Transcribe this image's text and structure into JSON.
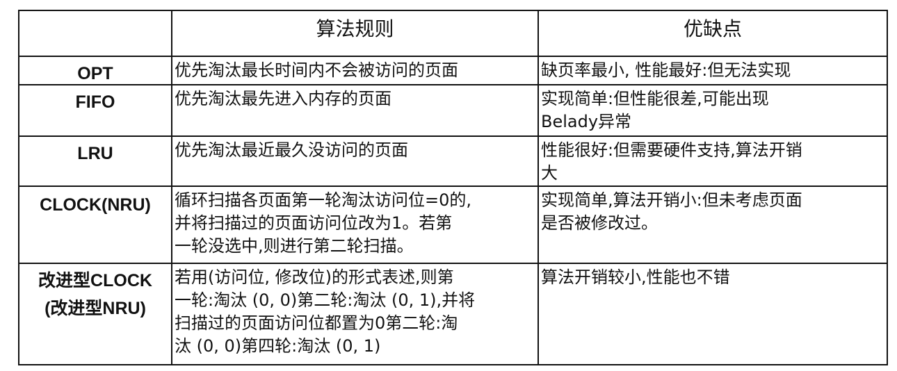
{
  "header": {
    "col1": "",
    "col2": "算法规则",
    "col3": "优缺点"
  },
  "rows": [
    {
      "name": "OPT",
      "rule": "优先淘汰最长时间内不会被访问的页面",
      "pros_cons": "缺页率最小, 性能最好:但无法实现"
    },
    {
      "name": "FIFO",
      "rule": "优先淘汰最先进入内存的页面",
      "pros_cons": "实现简单:但性能很差,可能出现\nBelady异常"
    },
    {
      "name": "LRU",
      "rule": "优先淘汰最近最久没访问的页面",
      "pros_cons": "性能很好:但需要硬件支持,算法开销\n大"
    },
    {
      "name": "CLOCK(NRU)",
      "rule": "循环扫描各页面第一轮淘汰访问位=0的,\n并将扫描过的页面访问位改为1。若第\n一轮没选中,则进行第二轮扫描。",
      "pros_cons": "实现简单,算法开销小:但未考虑页面\n是否被修改过。"
    },
    {
      "name": "改进型CLOCK\n(改进型NRU)",
      "rule": "若用(访问位, 修改位)的形式表述,则第\n一轮:淘汰 (0, 0)第二轮:淘汰 (0, 1),并将\n扫描过的页面访问位都置为0第二轮:淘\n汰 (0, 0)第四轮:淘汰 (0, 1)",
      "pros_cons": "算法开销较小,性能也不错"
    }
  ]
}
